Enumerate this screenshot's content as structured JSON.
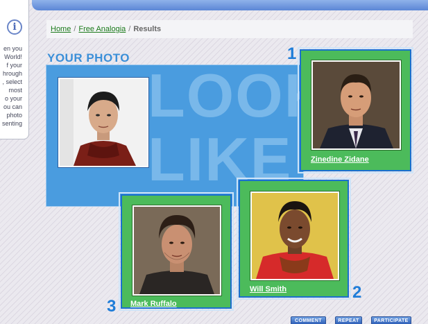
{
  "info": {
    "lines": [
      "en you",
      "World!",
      "f your",
      "hrough",
      ", select",
      "most",
      "o your",
      "ou can",
      "photo",
      "senting"
    ]
  },
  "breadcrumb": {
    "home": "Home",
    "sep1": "/",
    "free_analogia": "Free Analogia",
    "sep2": "/",
    "current": "Results"
  },
  "your_photo": {
    "title": "YOUR PHOTO"
  },
  "background_words": [
    "LOOK",
    "LIKE"
  ],
  "matches": [
    {
      "rank": "1",
      "name": "Zinedine Zidane"
    },
    {
      "rank": "2",
      "name": "Will Smith"
    },
    {
      "rank": "3",
      "name": "Mark Ruffalo"
    }
  ],
  "buttons": {
    "comment": "COMMENT",
    "repeat": "REPEAT",
    "participate": "PARTICIPATE"
  },
  "colors": {
    "accent_blue": "#4a9cdf",
    "card_green": "#4cbb5b",
    "link_green": "#1a7a1a"
  }
}
